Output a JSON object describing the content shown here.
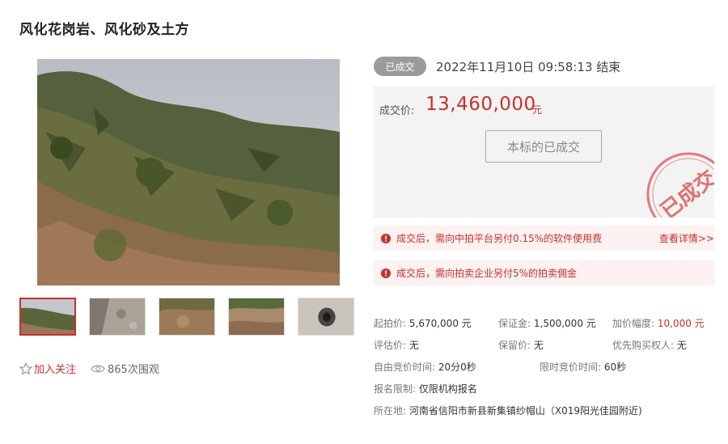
{
  "title": "风化花岗岩、风化砂及土方",
  "status": {
    "badge": "已成交",
    "end_time": "2022年11月10日  09:58:13 结束"
  },
  "price": {
    "label": "成交价:",
    "value": "13,460,000",
    "unit": "元",
    "button": "本标的已成交",
    "stamp_text": "已成交"
  },
  "notices": [
    {
      "text": "成交后，需向中拍平台另付0.15%的软件使用费",
      "link": "查看详情>>"
    },
    {
      "text": "成交后，需向拍卖企业另付5%的拍卖佣金"
    }
  ],
  "info": {
    "start_price": {
      "label": "起拍价:",
      "value": "5,670,000 元"
    },
    "deposit": {
      "label": "保证金:",
      "value": "1,500,000 元"
    },
    "increment": {
      "label": "加价幅度:",
      "value": "10,000 元"
    },
    "appraisal": {
      "label": "评估价:",
      "value": "无"
    },
    "reserve": {
      "label": "保留价:",
      "value": "无"
    },
    "priority": {
      "label": "优先购买权人:",
      "value": "无"
    },
    "free_time": {
      "label": "自由竞价时间:",
      "value": "20分0秒"
    },
    "limit_time": {
      "label": "限时竞价时间:",
      "value": "60秒"
    },
    "restriction": {
      "label": "报名限制:",
      "value": "仅限机构报名"
    },
    "location": {
      "label": "所在地:",
      "value": "河南省信阳市新县新集镇纱帽山（X019阳光佳园附近)"
    }
  },
  "actions": {
    "follow": "加入关注",
    "views": "865次围观"
  },
  "colors": {
    "accent": "#c9302c",
    "badge_gray": "#9b9b9b",
    "price_box_bg": "#f3f3f3",
    "notice_bg": "#fdf1f1"
  }
}
